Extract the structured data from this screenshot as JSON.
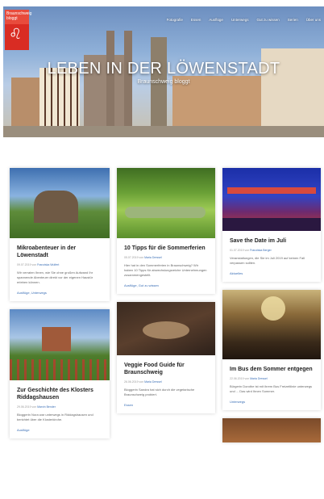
{
  "logo": {
    "text": "Braunschweig bloggt"
  },
  "nav": [
    "Fotografie",
    "Essen",
    "Ausflüge",
    "Unterwegs",
    "Gut zu wissen",
    "Serien",
    "Über uns"
  ],
  "hero": {
    "title": "LEBEN IN DER LÖWENSTADT",
    "subtitle": "Braunschweig bloggt"
  },
  "columns": [
    [
      {
        "title": "Mikroabenteuer in der Löwenstadt",
        "date": "09.07.2019",
        "author": "Franziska Wulfert",
        "excerpt": "Wir verraten Ihnen, wie Sie ohne großen Aufwand Ihr spannende Abenteuer direkt vor der eigenen Haustür erleben können.",
        "category": "Ausflüge, Unterwegs",
        "image": "castle-ruin"
      },
      {
        "title": "Zur Geschichte des Klosters Riddagshausen",
        "date": "29.06.2019",
        "author": "Marvin Bender",
        "excerpt": "Bloggerin Nora war unterwegs in Riddagshausen und berichtet über die Klosterkirche.",
        "category": "Ausflüge",
        "image": "monastery"
      }
    ],
    [
      {
        "title": "10 Tipps für die Sommerferien",
        "date": "05.07.2019",
        "author": "Maria Dressel",
        "excerpt": "Hier hat in den Sommerferien in Braunschweig? Wir haben 10 Tipps für abwechslungsreiche Unternehmungen zusammengestellt.",
        "category": "Ausflüge, Gut zu wissen",
        "image": "river"
      },
      {
        "title": "Veggie Food Guide für Braunschweig",
        "date": "26.06.2019",
        "author": "Maria Dressel",
        "excerpt": "Bloggerin Sandra hat sich durch die vegetarische Braunschweig probiert.",
        "category": "Essen",
        "image": "veggie"
      }
    ],
    [
      {
        "title": "Save the Date im Juli",
        "date": "01.07.2019",
        "author": "Franziska Berger",
        "excerpt": "Veranstaltungen, die Sie im Juli 2019 auf keinen Fall verpassen sollten.",
        "category": "Aktuelles",
        "image": "stage"
      },
      {
        "title": "Im Bus dem Sommer entgegen",
        "date": "22.06.2019",
        "author": "Maria Dressel",
        "excerpt": "Bürgerin Dorothe ist mit ihrem Bus Freizeitlinie unterwegs und ... Das wird Ihnen Sommer.",
        "category": "Unterwegs",
        "image": "crowd"
      }
    ]
  ]
}
